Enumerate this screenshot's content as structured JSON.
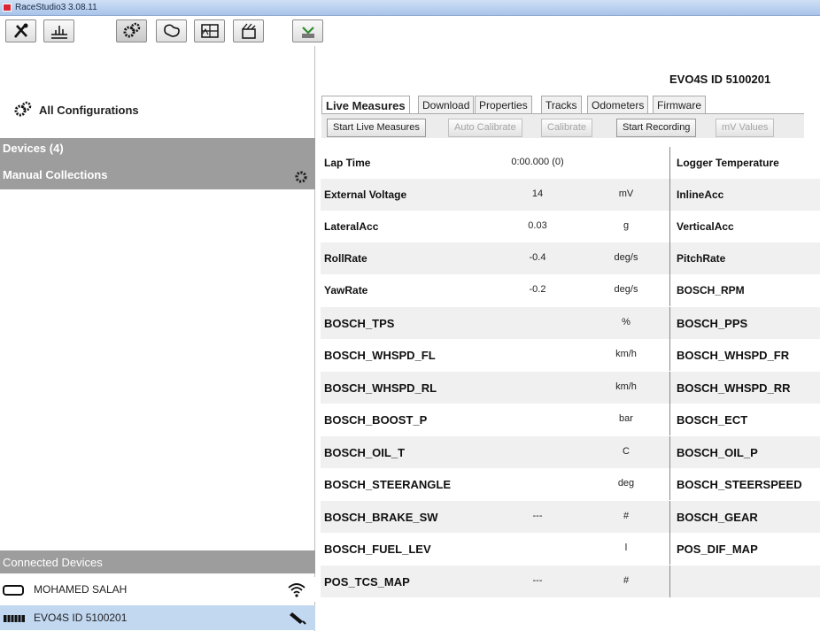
{
  "window": {
    "title": "RaceStudio3 3.08.11"
  },
  "toolbar": {
    "buttons": [
      {
        "icon": "tools-icon"
      },
      {
        "icon": "analysis-icon"
      },
      {
        "icon": "configuration-icon"
      },
      {
        "icon": "tracks-icon"
      },
      {
        "icon": "dashboard-icon"
      },
      {
        "icon": "video-icon"
      },
      {
        "icon": "download-icon"
      }
    ]
  },
  "sidebar": {
    "all_configurations": "All Configurations",
    "devices": "Devices (4)",
    "manual_collections": "Manual Collections",
    "connected_devices": "Connected Devices",
    "connected": [
      {
        "label": "MOHAMED SALAH",
        "icon": "wifi-icon"
      },
      {
        "label": "EVO4S ID 5100201",
        "icon": "usb-plug-icon"
      }
    ]
  },
  "device": {
    "title": "EVO4S ID 5100201"
  },
  "tabs": [
    "Live Measures",
    "Download",
    "Properties",
    "Tracks",
    "Odometers",
    "Firmware"
  ],
  "actions": [
    "Start Live Measures",
    "Auto Calibrate",
    "Calibrate",
    "Start Recording",
    "mV Values"
  ],
  "measures": [
    {
      "name": "Lap Time",
      "value": "0:00.000 (0)",
      "unit": "",
      "right": "Logger Temperature"
    },
    {
      "name": "External Voltage",
      "value": "14",
      "unit": "mV",
      "right": "InlineAcc"
    },
    {
      "name": "LateralAcc",
      "value": "0.03",
      "unit": "g",
      "right": "VerticalAcc"
    },
    {
      "name": "RollRate",
      "value": "-0.4",
      "unit": "deg/s",
      "right": "PitchRate"
    },
    {
      "name": "YawRate",
      "value": "-0.2",
      "unit": "deg/s",
      "right": "BOSCH_RPM"
    },
    {
      "name": "BOSCH_TPS",
      "value": "",
      "unit": "%",
      "right": "BOSCH_PPS"
    },
    {
      "name": "BOSCH_WHSPD_FL",
      "value": "",
      "unit": "km/h",
      "right": "BOSCH_WHSPD_FR"
    },
    {
      "name": "BOSCH_WHSPD_RL",
      "value": "",
      "unit": "km/h",
      "right": "BOSCH_WHSPD_RR"
    },
    {
      "name": "BOSCH_BOOST_P",
      "value": "",
      "unit": "bar",
      "right": "BOSCH_ECT"
    },
    {
      "name": "BOSCH_OIL_T",
      "value": "",
      "unit": "C",
      "right": "BOSCH_OIL_P"
    },
    {
      "name": "BOSCH_STEERANGLE",
      "value": "",
      "unit": "deg",
      "right": "BOSCH_STEERSPEED"
    },
    {
      "name": "BOSCH_BRAKE_SW",
      "value": "---",
      "unit": "#",
      "right": "BOSCH_GEAR"
    },
    {
      "name": "BOSCH_FUEL_LEV",
      "value": "",
      "unit": "l",
      "right": "POS_DIF_MAP"
    },
    {
      "name": "POS_TCS_MAP",
      "value": "---",
      "unit": "#",
      "right": ""
    }
  ]
}
